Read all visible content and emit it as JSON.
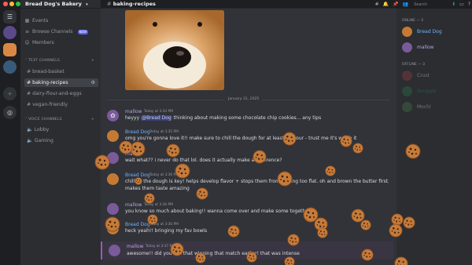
{
  "titlebar": {
    "dots": [
      "#ff5f57",
      "#febc2e",
      "#28c840"
    ]
  },
  "server_header": {
    "name": "Bread Dog's Bakery",
    "chevron": "chevron-down-icon"
  },
  "nav": [
    {
      "label": "Events",
      "icon": "calendar-icon"
    },
    {
      "label": "Browse Channels",
      "icon": "browse-icon",
      "badge": "NEW"
    },
    {
      "label": "Members",
      "icon": "members-icon"
    }
  ],
  "text_category": "TEXT CHANNELS",
  "text_channels": [
    "bread-basket",
    "baking-recipes",
    "dairy-flour-and-eggs",
    "vegan-friendly"
  ],
  "active_channel": "baking-recipes",
  "voice_category": "VOICE CHANNELS",
  "voice_channels": [
    "Lobby",
    "Gaming"
  ],
  "chat_header": {
    "channel": "baking-recipes",
    "search_placeholder": "Search"
  },
  "date_divider": "January 31, 2025",
  "messages": [
    {
      "user": "mallow",
      "time": "Today at 3:34 PM",
      "color": "#b9a2e6",
      "mention": "@Bread Dog",
      "text": "thinking about making some chocolate chip cookies... any tips",
      "pre": "heyyy "
    },
    {
      "user": "Bread Dog",
      "time": "Today at 3:35 PM",
      "color": "#6fb3ff",
      "text": "omg you're gonna love it!! make sure to chill the dough for at least an hour - trust me it's worth it"
    },
    {
      "user": "mallow",
      "time": "",
      "color": "#b9a2e6",
      "text": "wait what?? i never do that lol. does it actually make a difference?"
    },
    {
      "user": "Bread Dog",
      "time": "Today at 3:36 PM",
      "color": "#6fb3ff",
      "text": "chilling the dough is key! helps develop flavor + stops them from getting too flat. oh and brown the butter first,",
      "text2": "makes them taste amazing"
    },
    {
      "user": "mallow",
      "time": "Today at 3:36 PM",
      "color": "#b9a2e6",
      "text": "you know so much about baking!! wanna come over and make some together?"
    },
    {
      "user": "Bread Dog",
      "time": "Today at 3:36 PM",
      "color": "#6fb3ff",
      "text": "heck yeah!! bringing my fav bowls"
    },
    {
      "user": "mallow",
      "time": "Today at 3:37 PM",
      "color": "#b9a2e6",
      "text": "awesome!! did you see that winning that match earlier! that was intense"
    }
  ],
  "members": {
    "online_label": "ONLINE — 2",
    "online": [
      {
        "name": "Bread Dog",
        "color": "#6fb3ff"
      },
      {
        "name": "mallow",
        "color": "#b9a2e6"
      }
    ],
    "offline_label": "OFFLINE — 3",
    "offline": [
      {
        "name": "Crust",
        "color": "#f2f3f5"
      },
      {
        "name": "Snuggle",
        "color": "#23a559"
      },
      {
        "name": "Mochi",
        "color": "#f2f3f5"
      }
    ]
  },
  "colors": {
    "accent": "#5865f2",
    "mention_bg": "#3c4270",
    "online": "#23a559",
    "cookie": "#c57b3b"
  }
}
